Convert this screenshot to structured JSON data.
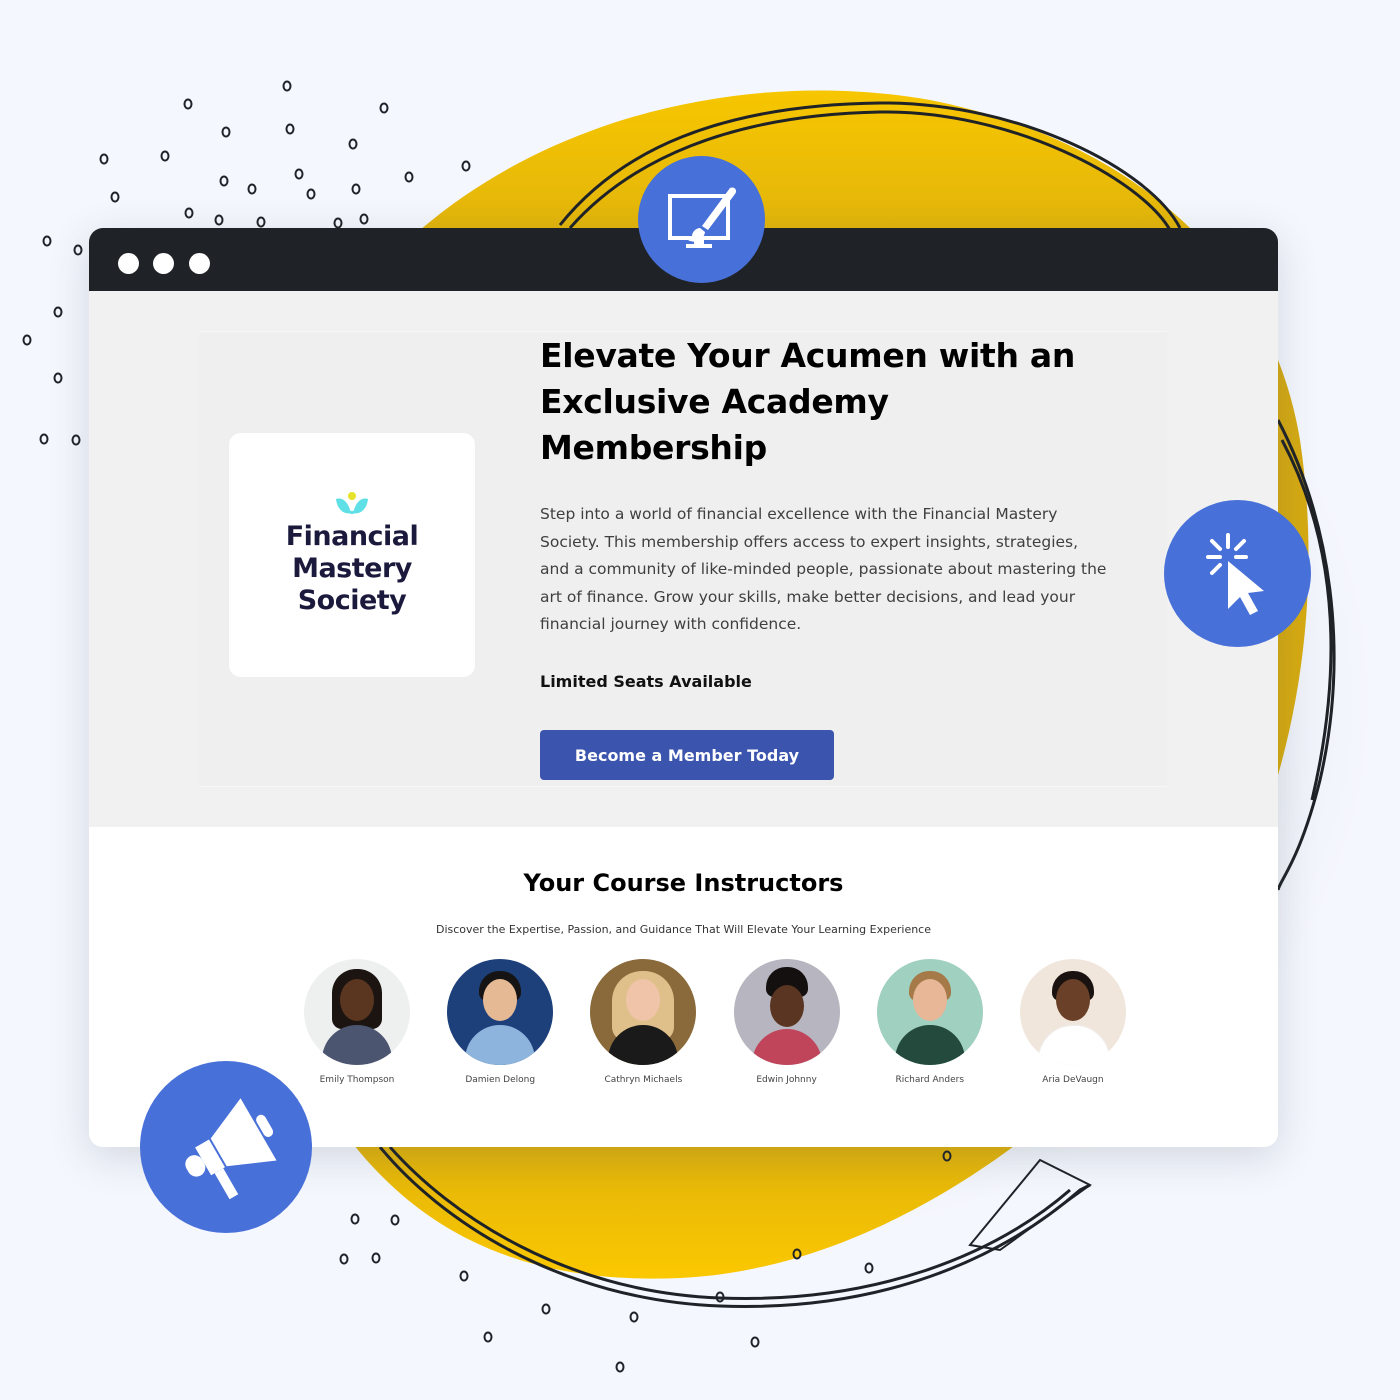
{
  "window": {
    "controls": [
      "close-dot",
      "minimize-dot",
      "maximize-dot"
    ]
  },
  "hero": {
    "logo": {
      "lines": [
        "Financial",
        "Mastery",
        "Society"
      ],
      "colors": {
        "text": "#1b1a3d",
        "leaf": "#5ee0e6",
        "sun": "#e6e32a"
      }
    },
    "headline": "Elevate Your Acumen with an Exclusive Academy Membership",
    "description": "Step into a world of financial excellence with the Financial Mastery Society. This membership offers access to expert insights, strategies, and a community of like-minded people, passionate about mastering the art of finance. Grow your skills, make better decisions, and lead your financial journey with confidence.",
    "availability": "Limited Seats Available",
    "cta_label": "Become a Member Today",
    "cta_color": "#3b55ae"
  },
  "instructors": {
    "title": "Your Course Instructors",
    "subtitle": "Discover the Expertise, Passion, and Guidance That Will Elevate Your Learning Experience",
    "people": [
      {
        "name": "Emily Thompson"
      },
      {
        "name": "Damien Delong"
      },
      {
        "name": "Cathryn Michaels"
      },
      {
        "name": "Edwin Johnny"
      },
      {
        "name": "Richard Anders"
      },
      {
        "name": "Aria DeVaugn"
      }
    ]
  },
  "badges": {
    "top": "monitor-paintbrush-icon",
    "right": "cursor-click-icon",
    "bottom_left": "megaphone-icon",
    "color": "#4870d9"
  },
  "decor": {
    "blob_color": "#f7c600",
    "scribble_color": "#1f2327"
  }
}
